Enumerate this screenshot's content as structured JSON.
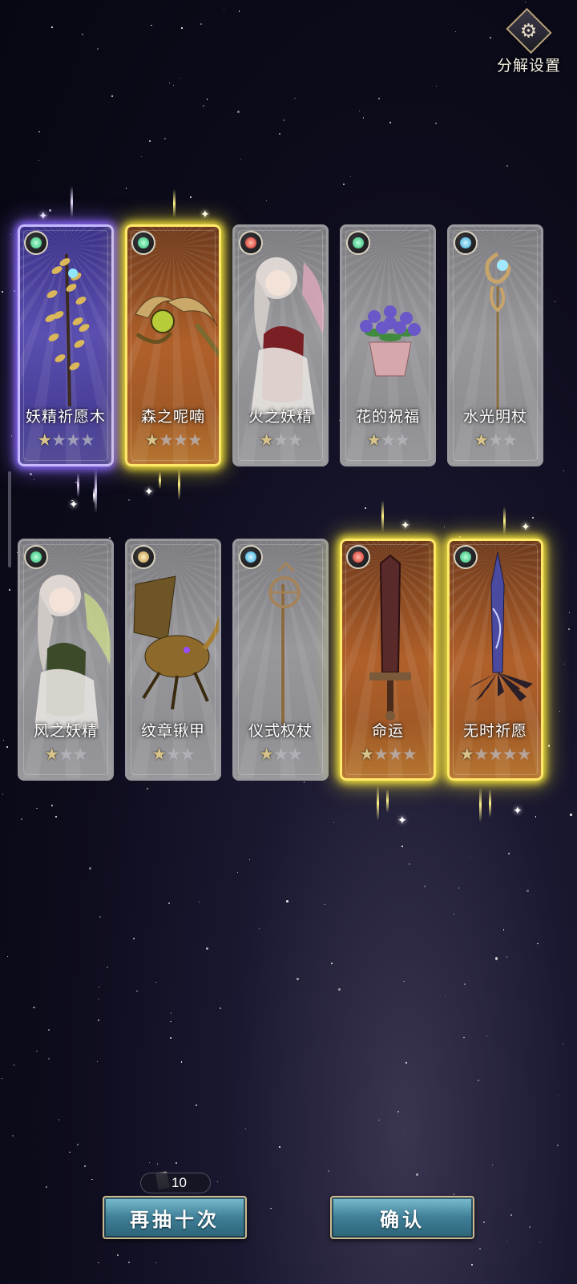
{
  "settings": {
    "label": "分解设置",
    "icon": "gear-icon"
  },
  "cards": [
    {
      "name": "妖精祈愿木",
      "element": "wind",
      "rarity": "purple",
      "stars_filled": 1,
      "stars_total": 4,
      "art": "fairy-branch-staff"
    },
    {
      "name": "森之呢喃",
      "element": "wind",
      "rarity": "gold",
      "stars_filled": 1,
      "stars_total": 4,
      "art": "twin-crescent-blades"
    },
    {
      "name": "火之妖精",
      "element": "fire",
      "rarity": "silver",
      "stars_filled": 1,
      "stars_total": 3,
      "art": "fire-fairy-girl"
    },
    {
      "name": "花的祝福",
      "element": "wind",
      "rarity": "silver",
      "stars_filled": 1,
      "stars_total": 3,
      "art": "flower-pot"
    },
    {
      "name": "水光明杖",
      "element": "water",
      "rarity": "silver",
      "stars_filled": 1,
      "stars_total": 3,
      "art": "water-light-staff"
    },
    {
      "name": "风之妖精",
      "element": "wind",
      "rarity": "silver",
      "stars_filled": 1,
      "stars_total": 3,
      "art": "wind-fairy-girl"
    },
    {
      "name": "纹章锹甲",
      "element": "earth",
      "rarity": "silver",
      "stars_filled": 1,
      "stars_total": 3,
      "art": "crest-beetle"
    },
    {
      "name": "仪式权杖",
      "element": "water",
      "rarity": "silver",
      "stars_filled": 1,
      "stars_total": 3,
      "art": "ritual-scepter"
    },
    {
      "name": "命运",
      "element": "fire",
      "rarity": "gold",
      "stars_filled": 1,
      "stars_total": 4,
      "art": "fate-greatsword"
    },
    {
      "name": "无时祈愿",
      "element": "wind",
      "rarity": "gold",
      "stars_filled": 1,
      "stars_total": 5,
      "art": "timeless-spear"
    }
  ],
  "draw_cost": {
    "icon": "ticket-icon",
    "value": "10"
  },
  "buttons": {
    "draw_again": "再抽十次",
    "confirm": "确认"
  },
  "colors": {
    "purple_glow": "#8b6cff",
    "gold_glow": "#f6e43a",
    "button_teal": "#3f7f97",
    "button_border": "#cdb98f"
  }
}
